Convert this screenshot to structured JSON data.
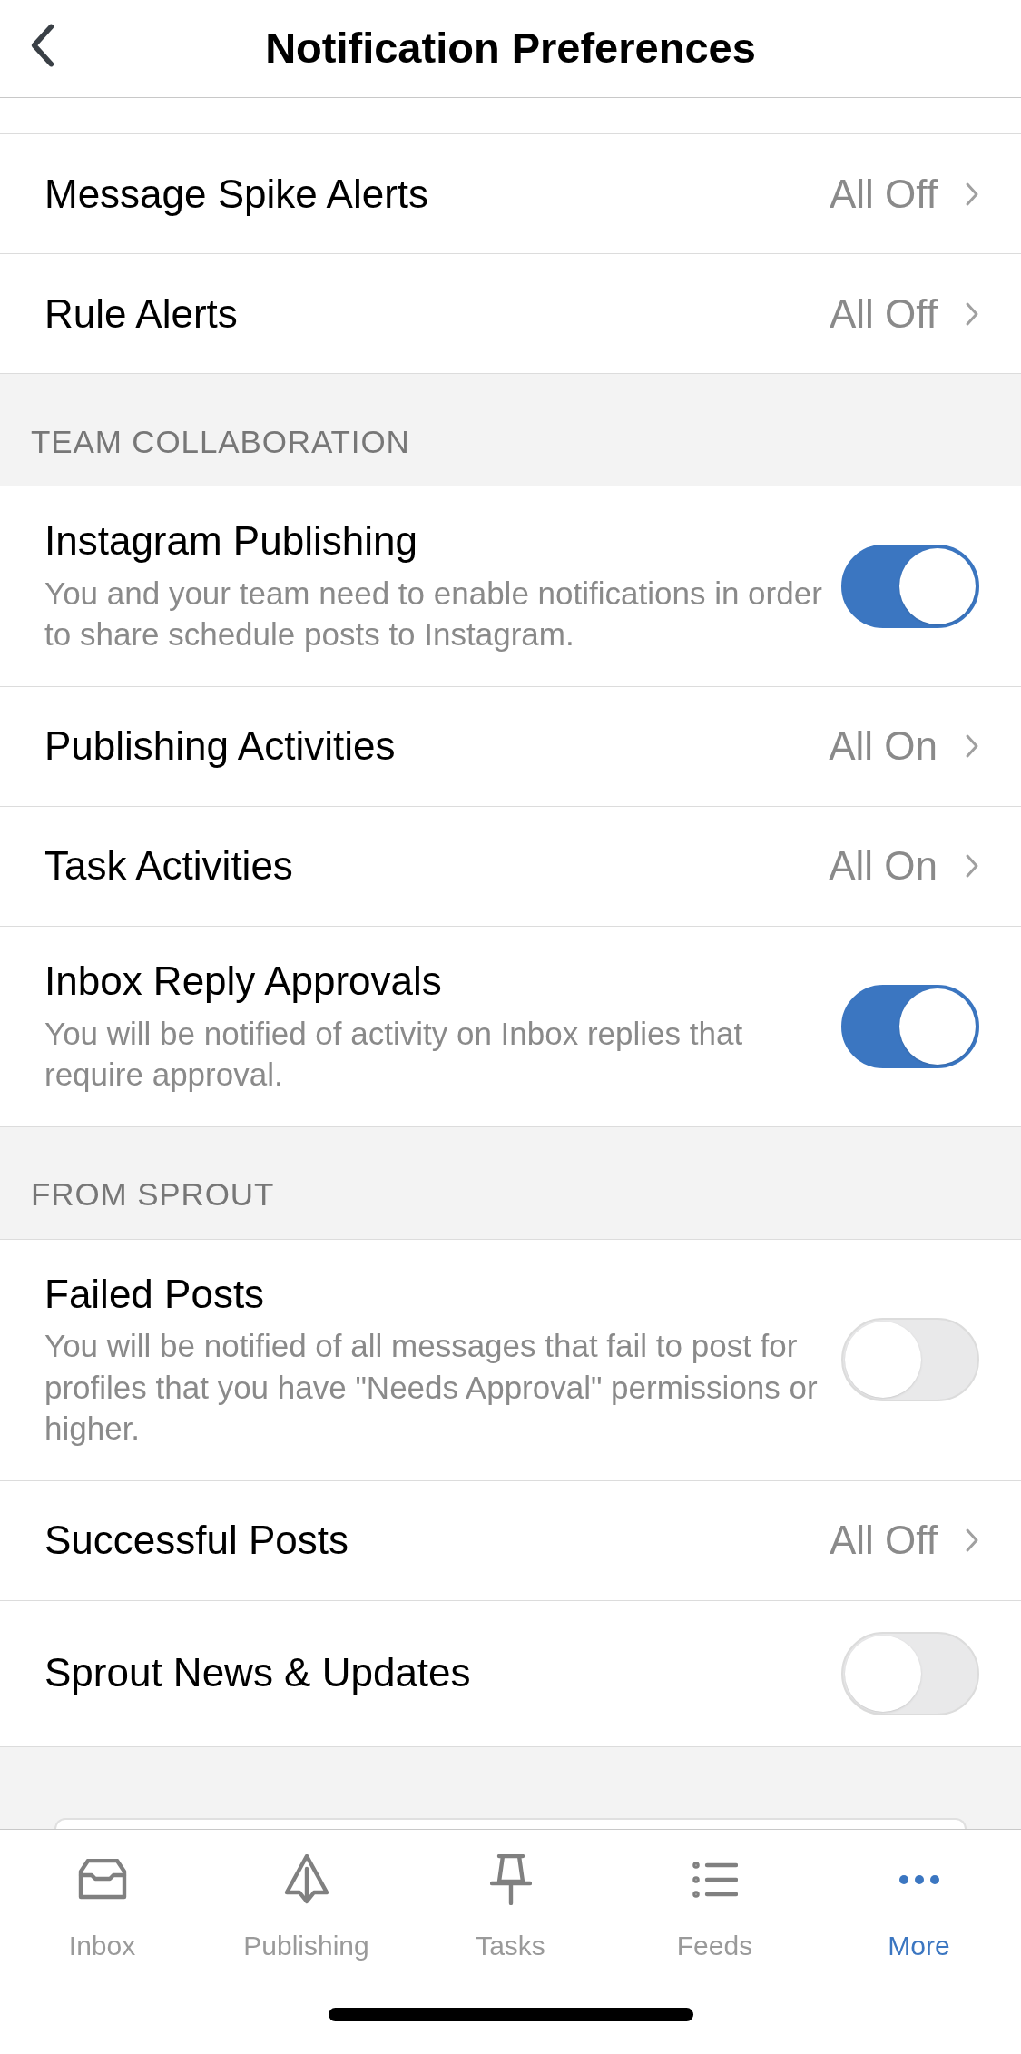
{
  "header": {
    "title": "Notification Preferences"
  },
  "sections": [
    {
      "items": [
        {
          "kind": "link",
          "label": "Message Spike Alerts",
          "value": "All Off"
        },
        {
          "kind": "link",
          "label": "Rule Alerts",
          "value": "All Off"
        }
      ]
    },
    {
      "title": "TEAM COLLABORATION",
      "items": [
        {
          "kind": "toggle",
          "label": "Instagram Publishing",
          "description": "You and your team need to enable notifications in order to share schedule posts to Instagram.",
          "on": true
        },
        {
          "kind": "link",
          "label": "Publishing Activities",
          "value": "All On"
        },
        {
          "kind": "link",
          "label": "Task Activities",
          "value": "All On"
        },
        {
          "kind": "toggle",
          "label": "Inbox Reply Approvals",
          "description": "You will be notified of activity on Inbox replies that require approval.",
          "on": true
        }
      ]
    },
    {
      "title": "FROM SPROUT",
      "items": [
        {
          "kind": "toggle",
          "label": "Failed Posts",
          "description": "You will be notified of all messages that fail to post for profiles that you have \"Needs Approval\" permissions or higher.",
          "on": false
        },
        {
          "kind": "link",
          "label": "Successful Posts",
          "value": "All Off"
        },
        {
          "kind": "toggle",
          "label": "Sprout News & Updates",
          "on": false
        }
      ]
    }
  ],
  "tab_bar": [
    {
      "kind": "inbox",
      "label": "Inbox",
      "selected": false
    },
    {
      "kind": "publishing",
      "label": "Publishing",
      "selected": false
    },
    {
      "kind": "tasks",
      "label": "Tasks",
      "selected": false
    },
    {
      "kind": "feeds",
      "label": "Feeds",
      "selected": false
    },
    {
      "kind": "more",
      "label": "More",
      "selected": true
    }
  ]
}
